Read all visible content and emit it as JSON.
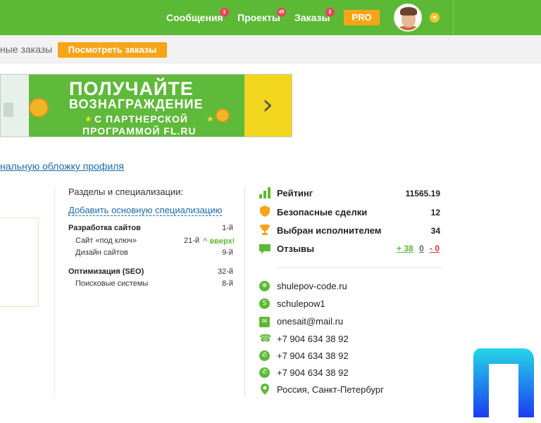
{
  "topbar": {
    "messages": {
      "label": "Сообщения",
      "badge": "1"
    },
    "projects": {
      "label": "Проекты",
      "badge": "45"
    },
    "orders": {
      "label": "Заказы",
      "badge": "2"
    },
    "pro": "PRO",
    "colors": {
      "green": "#5cb935",
      "orange": "#f7a418",
      "badge": "#e3465b"
    }
  },
  "subbar": {
    "text": "ные заказы",
    "button": "Посмотреть заказы"
  },
  "banner": {
    "line1": "ПОЛУЧАЙТЕ",
    "line2": "ВОЗНАГРАЖДЕНИЕ",
    "line3": "С ПАРТНЕРСКОЙ",
    "line4": "ПРОГРАММОЙ FL.RU",
    "arrow": "›"
  },
  "cover_link": "нальную обложку профиля",
  "specs": {
    "title": "Разделы и специализации:",
    "add": "Добавить основную специализацию",
    "groups": [
      {
        "name": "Разработка сайтов",
        "rank": "1-й",
        "items": [
          {
            "name": "Сайт «под ключ»",
            "rank": "21-й",
            "trend": "^ вверх!"
          },
          {
            "name": "Дизайн сайтов",
            "rank": "9-й"
          }
        ]
      },
      {
        "name": "Оптимизация (SEO)",
        "rank": "32-й",
        "items": [
          {
            "name": "Поисковые системы",
            "rank": "8-й"
          }
        ]
      }
    ]
  },
  "stats": [
    {
      "label": "Рейтинг",
      "value": "11565.19",
      "icon": "rating-bars-icon"
    },
    {
      "label": "Безопасные сделки",
      "value": "12",
      "icon": "shield-icon"
    },
    {
      "label": "Выбран исполнителем",
      "value": "34",
      "icon": "trophy-icon"
    },
    {
      "label": "Отзывы",
      "icon": "speech-bubble-icon"
    }
  ],
  "reviews": {
    "positive": "+ 38",
    "neutral": "0",
    "negative": "- 0"
  },
  "contacts": [
    {
      "text": "shulepov-code.ru",
      "icon": "globe-icon"
    },
    {
      "text": "schulepow1",
      "icon": "skype-icon"
    },
    {
      "text": "onesait@mail.ru",
      "icon": "mail-icon"
    },
    {
      "text": "+7 904 634 38 92",
      "icon": "phone-icon"
    },
    {
      "text": "+7 904 634 38 92",
      "icon": "viber-icon"
    },
    {
      "text": "+7 904 634 38 92",
      "icon": "whatsapp-icon"
    },
    {
      "text": "Россия, Санкт-Петербург",
      "icon": "location-pin-icon"
    }
  ]
}
